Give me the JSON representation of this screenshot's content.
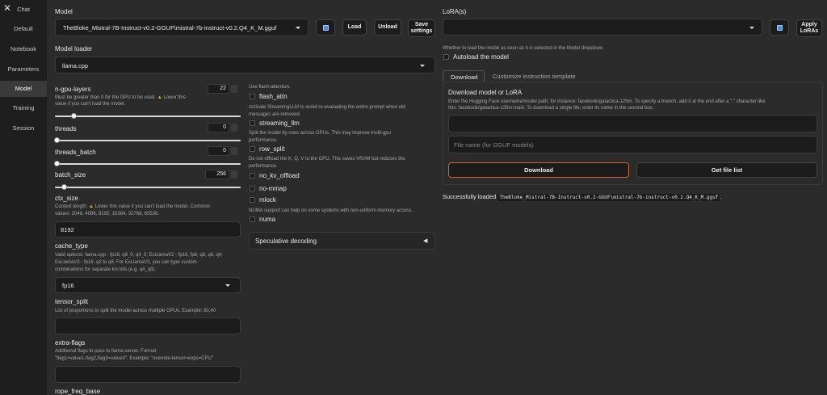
{
  "sidebar": {
    "close_glyph": "✕",
    "items": [
      {
        "label": "Chat"
      },
      {
        "label": "Default"
      },
      {
        "label": "Notebook"
      },
      {
        "label": "Parameters"
      },
      {
        "label": "Model"
      },
      {
        "label": "Training"
      },
      {
        "label": "Session"
      }
    ],
    "active": "Model"
  },
  "model": {
    "label": "Model",
    "selected": "TheBloke_Mistral-7B-Instruct-v0.2-GGUF\\mistral-7b-instruct-v0.2.Q4_K_M.gguf",
    "load_label": "Load",
    "unload_label": "Unload",
    "save_settings_label_1": "Save",
    "save_settings_label_2": "settings"
  },
  "loader": {
    "label": "Model loader",
    "selected": "llama.cpp"
  },
  "n_gpu_layers": {
    "label": "n-gpu-layers",
    "value": "22",
    "note_1a": "Must be greater than 0 for the GPU to be used.",
    "note_1b": "Lower this",
    "note_2": "value if you can't load the model.",
    "fraction": 0.08
  },
  "threads": {
    "label": "threads",
    "value": "0",
    "fraction": 0
  },
  "threads_batch": {
    "label": "threads_batch",
    "value": "0",
    "fraction": 0
  },
  "batch_size": {
    "label": "batch_size",
    "value": "256",
    "fraction": 0.04
  },
  "ctx_size": {
    "label": "ctx_size",
    "note_1a": "Context length.",
    "note_1b": "Lower this value if you can't load the model. Common",
    "note_2": "values: 2048, 4096, 8192, 16384, 32768, 65536.",
    "value": "8192"
  },
  "cache_type": {
    "label": "cache_type",
    "note_1": "Valid options: llama.cpp - fp16, q8_0, q4_0; ExLlamaV2 - fp16, fp8, q8, q6, q4;",
    "note_2": "ExLlamaV3 - fp16, q2 to q8. For ExLlamaV3, you can type custom",
    "note_3": "combinations for separate k/v bits (e.g. q4_q8).",
    "selected": "fp16"
  },
  "tensor_split": {
    "label": "tensor_split",
    "note": "List of proportions to split the model across multiple GPUs. Example: 60,40"
  },
  "extra_flags": {
    "label": "extra-flags",
    "note_1": "Additional flags to pass to llama-server. Format:",
    "note_2": "\"flag1=value1,flag2,flag3=value3\". Example: \"override-tensor=exps=CPU\""
  },
  "rope_freq_base": {
    "label": "rope_freq_base"
  },
  "flags": {
    "flash_attn_note": "Use flash-attention.",
    "flash_attn": "flash_attn",
    "streaming_note_1": "Activate StreamingLLM to avoid re-evaluating the entire prompt when old",
    "streaming_note_2": "messages are removed.",
    "streaming_llm": "streaming_llm",
    "row_split_note_1": "Split the model by rows across GPUs. This may improve multi-gpu",
    "row_split_note_2": "performance.",
    "row_split": "row_split",
    "no_kv_note_1": "Do not offload the K, Q, V to the GPU. This saves VRAM but reduces the",
    "no_kv_note_2": "performance.",
    "no_kv_offload": "no_kv_offload",
    "no_mmap": "no-mmap",
    "mlock": "mlock",
    "numa_note": "NUMA support can help on some systems with non-uniform memory access.",
    "numa": "numa"
  },
  "speculative": {
    "label": "Speculative decoding",
    "glyph": "◀"
  },
  "lora": {
    "label": "LoRA(s)",
    "apply_label_1": "Apply",
    "apply_label_2": "LoRAs",
    "autoload_note": "Whether to load the model as soon as it is selected in the Model dropdown.",
    "autoload_label": "Autoload the model"
  },
  "tabs": [
    {
      "label": "Download"
    },
    {
      "label": "Customize instruction template"
    }
  ],
  "download": {
    "title": "Download model or LoRA",
    "note_1": "Enter the Hugging Face username/model path, for instance: facebook/galactica-125m. To specify a branch, add it at the end after a \":\" character like",
    "note_2": "this: facebook/galactica-125m:main. To download a single file, enter its name in the second box.",
    "filename_placeholder": "File name (for GGUF models)",
    "download_label": "Download",
    "get_file_list_label": "Get file list"
  },
  "status": {
    "prefix": "Successfully loaded",
    "model": "TheBloke_Mistral-7B-Instruct-v0.2-GGUF\\mistral-7b-instruct-v0.2.Q4_K_M.gguf",
    "suffix": "."
  },
  "icons": {
    "refresh": "refresh-icon",
    "warning": "warning-icon",
    "dropdown": "chevron-down-icon"
  },
  "colors": {
    "accent_border": "#d0662c",
    "warn": "#f5b800"
  }
}
